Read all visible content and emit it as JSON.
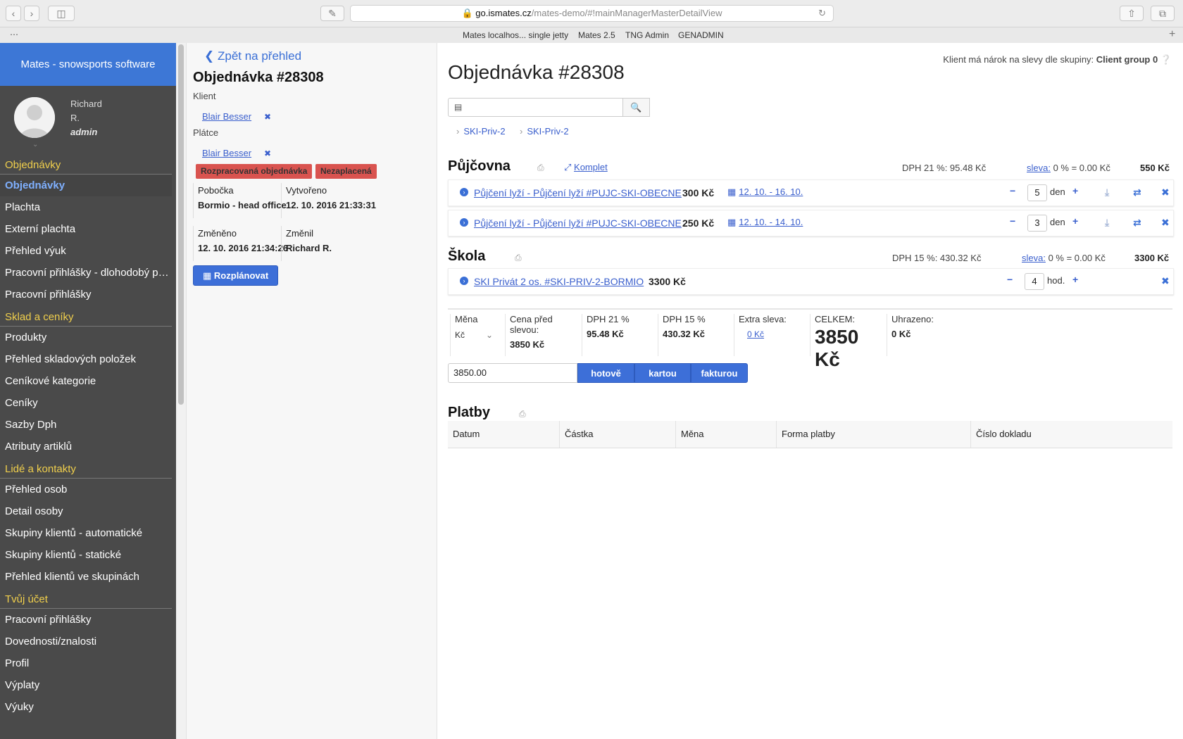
{
  "browser": {
    "url_host": "go.ismates.cz",
    "url_path": "/mates-demo/#!mainManagerMasterDetailView",
    "bookmarks": [
      "Mates localhos... single jetty",
      "Mates 2.5",
      "TNG Admin",
      "GENADMIN"
    ]
  },
  "sidebar": {
    "brand": "Mates - snowsports software",
    "user": {
      "first": "Richard",
      "last": "R.",
      "role": "admin"
    },
    "sections": [
      {
        "title": "Objednávky",
        "items": [
          "Objednávky",
          "Plachta",
          "Externí plachta",
          "Přehled výuk",
          "Pracovní přihlášky - dlohodobý pře...",
          "Pracovní přihlášky"
        ]
      },
      {
        "title": "Sklad a ceníky",
        "items": [
          "Produkty",
          "Přehled skladových položek",
          "Ceníkové kategorie",
          "Ceníky",
          "Sazby Dph",
          "Atributy artiklů"
        ]
      },
      {
        "title": "Lidé a kontakty",
        "items": [
          "Přehled osob",
          "Detail osoby",
          "Skupiny klientů - automatické",
          "Skupiny klientů - statické",
          "Přehled klientů ve skupinách"
        ]
      },
      {
        "title": "Tvůj účet",
        "items": [
          "Pracovní přihlášky",
          "Dovednosti/znalosti",
          "Profil",
          "Výplaty",
          "Výuky"
        ]
      }
    ]
  },
  "detail": {
    "back": "Zpět na přehled",
    "title": "Objednávka #28308",
    "client_label": "Klient",
    "client": "Blair Besser",
    "payer_label": "Plátce",
    "payer": "Blair Besser",
    "tags": [
      "Rozpracovaná objednávka",
      "Nezaplacená"
    ],
    "branch_label": "Pobočka",
    "branch": "Bormio - head office",
    "created_label": "Vytvořeno",
    "created": "12. 10. 2016 21:33:31",
    "changed_label": "Změněno",
    "changed": "12. 10. 2016 21:34:26",
    "changed_by_label": "Změnil",
    "changed_by": "Richard R.",
    "schedule_button": "Rozplánovat"
  },
  "order": {
    "client_group_text": "Klient má nárok na slevy dle skupiny:",
    "client_group": "Client group 0",
    "title": "Objednávka #28308",
    "breadcrumbs": [
      "SKI-Priv-2",
      "SKI-Priv-2"
    ],
    "rental": {
      "title": "Půjčovna",
      "komplet": "Komplet",
      "vat": "DPH 21 %: 95.48 Kč",
      "discount_label": "sleva:",
      "discount": "0 % = 0.00 Kč",
      "total": "550 Kč",
      "items": [
        {
          "name": "Půjčení lyží - Půjčení lyží #PUJC-SKI-OBECNE",
          "price": "300 Kč",
          "dates": "12. 10. - 16. 10.",
          "qty": "5",
          "unit": "den"
        },
        {
          "name": "Půjčení lyží - Půjčení lyží #PUJC-SKI-OBECNE",
          "price": "250 Kč",
          "dates": "12. 10. - 14. 10.",
          "qty": "3",
          "unit": "den"
        }
      ]
    },
    "school": {
      "title": "Škola",
      "vat": "DPH 15 %: 430.32 Kč",
      "discount_label": "sleva:",
      "discount": "0 % = 0.00 Kč",
      "total": "3300 Kč",
      "items": [
        {
          "name": "SKI Privát 2 os. #SKI-PRIV-2-BORMIO",
          "price": "3300 Kč",
          "qty": "4",
          "unit": "hod."
        }
      ]
    },
    "summary": {
      "currency_label": "Měna",
      "currency": "Kč",
      "pre_discount_label": "Cena před slevou:",
      "pre_discount": "3850 Kč",
      "vat21_label": "DPH 21 %",
      "vat21": "95.48 Kč",
      "vat15_label": "DPH 15 %",
      "vat15": "430.32 Kč",
      "extra_label": "Extra sleva:",
      "extra": "0 Kč",
      "total_label": "CELKEM:",
      "total": "3850 Kč",
      "paid_label": "Uhrazeno:",
      "paid": "0 Kč"
    },
    "payment": {
      "amount": "3850.00",
      "cash": "hotově",
      "card": "kartou",
      "invoice": "fakturou"
    },
    "payments": {
      "title": "Platby",
      "columns": [
        "Datum",
        "Částka",
        "Měna",
        "Forma platby",
        "Číslo dokladu"
      ]
    }
  }
}
